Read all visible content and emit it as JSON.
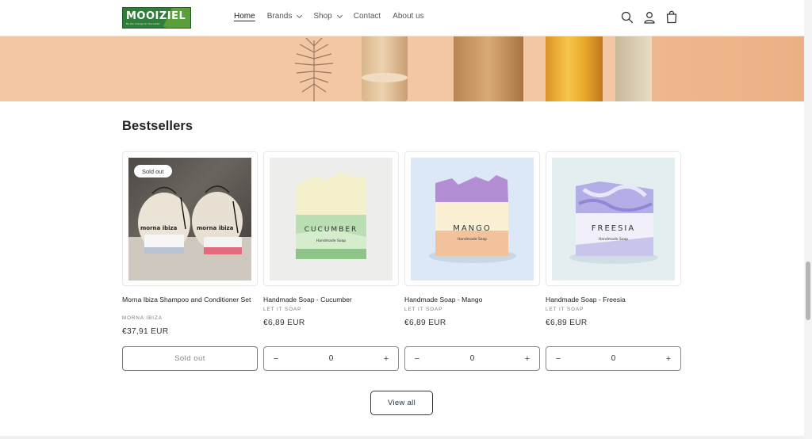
{
  "header": {
    "logo_text": "MOOIZIEL",
    "logo_tagline": "Be the change for the better",
    "nav": [
      {
        "label": "Home",
        "active": true,
        "dropdown": false
      },
      {
        "label": "Brands",
        "active": false,
        "dropdown": true
      },
      {
        "label": "Shop",
        "active": false,
        "dropdown": true
      },
      {
        "label": "Contact",
        "active": false,
        "dropdown": false
      },
      {
        "label": "About us",
        "active": false,
        "dropdown": false
      }
    ],
    "icons": [
      "search-icon",
      "account-icon",
      "cart-icon"
    ]
  },
  "section": {
    "title": "Bestsellers"
  },
  "products": [
    {
      "title": "Morna Ibiza Shampoo and Conditioner Set",
      "vendor": "MORNA IBIZA",
      "price": "€37,91 EUR",
      "badge": "Sold out",
      "sold_out": true,
      "button_label": "Sold out",
      "image_text": [
        "morna ibiza",
        "morna ibiza"
      ]
    },
    {
      "title": "Handmade Soap - Cucumber",
      "vendor": "LET IT SOAP",
      "price": "€6,89 EUR",
      "sold_out": false,
      "quantity": "0",
      "image_text": "CUCUMBER",
      "image_subtext": "Handmade Soap"
    },
    {
      "title": "Handmade Soap - Mango",
      "vendor": "LET IT SOAP",
      "price": "€6,89 EUR",
      "sold_out": false,
      "quantity": "0",
      "image_text": "MANGO",
      "image_subtext": "Handmade Soap"
    },
    {
      "title": "Handmade Soap - Freesia",
      "vendor": "LET IT SOAP",
      "price": "€6,89 EUR",
      "sold_out": false,
      "quantity": "0",
      "image_text": "FREESIA",
      "image_subtext": "Handmade Soap"
    }
  ],
  "quantity_controls": {
    "minus": "−",
    "plus": "+"
  },
  "view_all_label": "View all",
  "colors": {
    "accent": "#1f2c3a",
    "hero_bg": "#f4c7a4",
    "logo_green": "#2e7d3a"
  }
}
